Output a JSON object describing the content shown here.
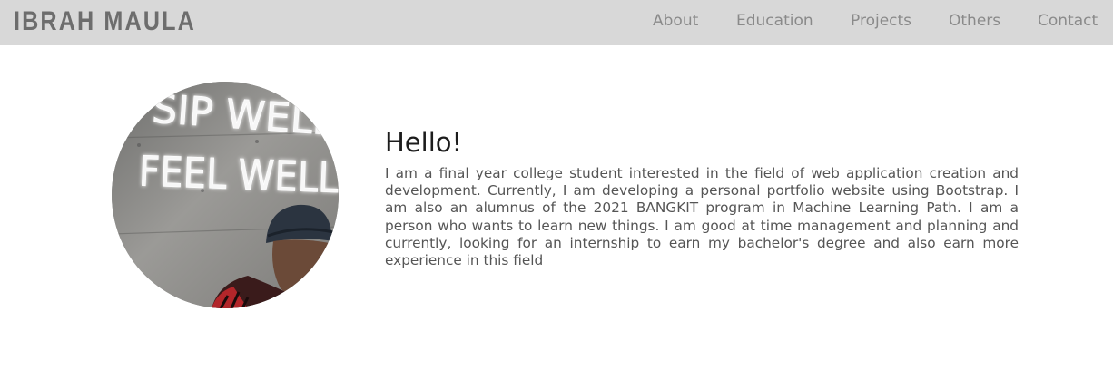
{
  "navbar": {
    "brand": "IBRAH MAULA",
    "links": [
      {
        "label": "About"
      },
      {
        "label": "Education"
      },
      {
        "label": "Projects"
      },
      {
        "label": "Others"
      },
      {
        "label": "Contact"
      }
    ]
  },
  "hero": {
    "photo_sign": {
      "line1": "SIP WELL,",
      "line2": "FEEL WELL"
    },
    "heading": "Hello!",
    "bio": "I am a final year college student interested in the field of web application creation and development. Currently, I am developing a personal portfolio website using Bootstrap. I am also an alumnus of the 2021 BANGKIT program in Machine Learning Path. I am a person who wants to learn new things. I am good at time management and planning and currently, looking for an internship to earn my bachelor's degree and also earn more experience in this field"
  },
  "colors": {
    "navbar_bg": "#d8d8d8",
    "brand": "#6d6d6d",
    "nav_link": "#8a8a8a",
    "heading": "#1c1c1c",
    "body_text": "#555555",
    "neon": "#ffffff"
  }
}
